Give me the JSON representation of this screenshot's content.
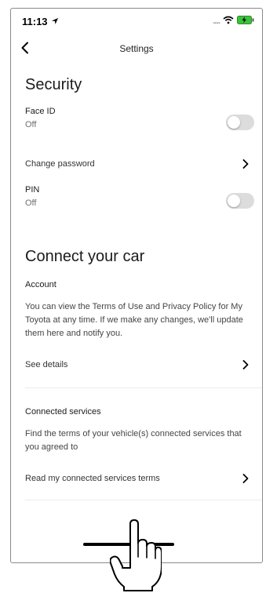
{
  "status_bar": {
    "time": "11:13",
    "signal": "....."
  },
  "nav": {
    "title": "Settings"
  },
  "security": {
    "title": "Security",
    "face_id": {
      "label": "Face ID",
      "status": "Off"
    },
    "change_password": {
      "label": "Change password"
    },
    "pin": {
      "label": "PIN",
      "status": "Off"
    }
  },
  "connect": {
    "title": "Connect your car",
    "account": {
      "heading": "Account",
      "description": "You can view the Terms of Use and Privacy Policy for My Toyota at any time. If we make any changes, we'll update them here and notify you.",
      "see_details": "See details"
    },
    "connected_services": {
      "heading": "Connected services",
      "description": "Find the terms of your vehicle(s) connected services that you agreed to",
      "read_terms": "Read my connected services terms"
    }
  },
  "colors": {
    "toggle_off": "#dcdcdc",
    "text": "#1b1b1b"
  },
  "icons": [
    "location-arrow-icon",
    "wifi-icon",
    "battery-icon",
    "back-chevron-icon",
    "chevron-right-icon",
    "tap-hand-icon"
  ]
}
